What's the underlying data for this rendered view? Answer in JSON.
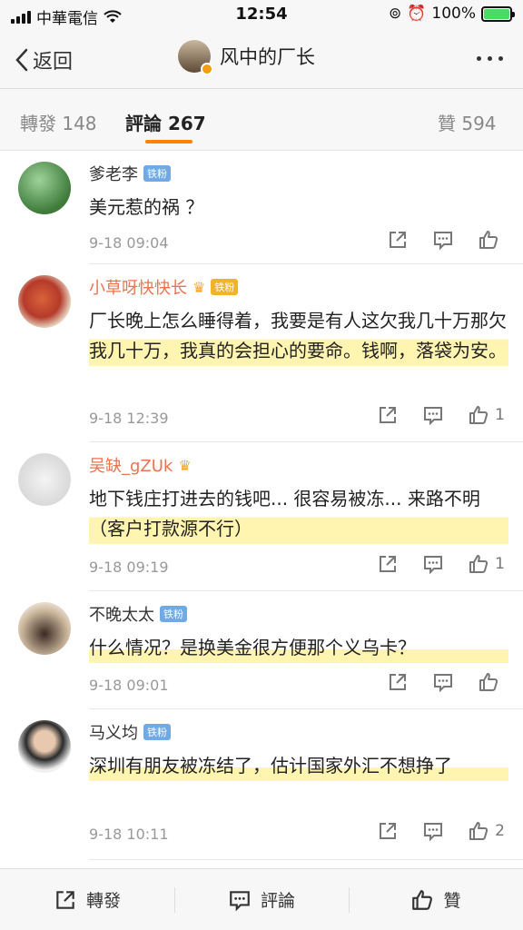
{
  "status_bar": {
    "carrier": "中華電信",
    "time": "12:54",
    "battery_percent": "100%"
  },
  "nav": {
    "back_label": "返回",
    "title": "风中的厂长"
  },
  "tabs": {
    "repost": "轉發 148",
    "comment": "評論 267",
    "like": "贊 594"
  },
  "comments": [
    {
      "username": "爹老李",
      "badge": "铁粉",
      "text": "美元惹的祸 ？",
      "time": "9-18 09:04",
      "likes": ""
    },
    {
      "username": "小草呀快快长",
      "badge": "铁粉",
      "text": "厂长晚上怎么睡得着，我要是有人这欠我几十万那欠我几十万，我真的会担心的要命。钱啊，落袋为安。",
      "time": "9-18 12:39",
      "likes": "1"
    },
    {
      "username": "吴缺_gZUk",
      "badge": "",
      "text": "地下钱庄打进去的钱吧... 很容易被冻... 来路不明 （客户打款源不行）",
      "time": "9-18 09:19",
      "likes": "1"
    },
    {
      "username": "不晚太太",
      "badge": "铁粉",
      "text": "什么情况？是换美金很方便那个义乌卡？",
      "time": "9-18 09:01",
      "likes": ""
    },
    {
      "username": "马义均",
      "badge": "铁粉",
      "text": "深圳有朋友被冻结了，估计国家外汇不想挣了",
      "time": "9-18 10:11",
      "likes": "2"
    }
  ],
  "bottom_bar": {
    "repost": "轉發",
    "comment": "評論",
    "like": "贊"
  },
  "colors": {
    "accent": "#ff8200",
    "username_highlight": "#eb7350",
    "fan_badge": "#6fa9e6"
  }
}
